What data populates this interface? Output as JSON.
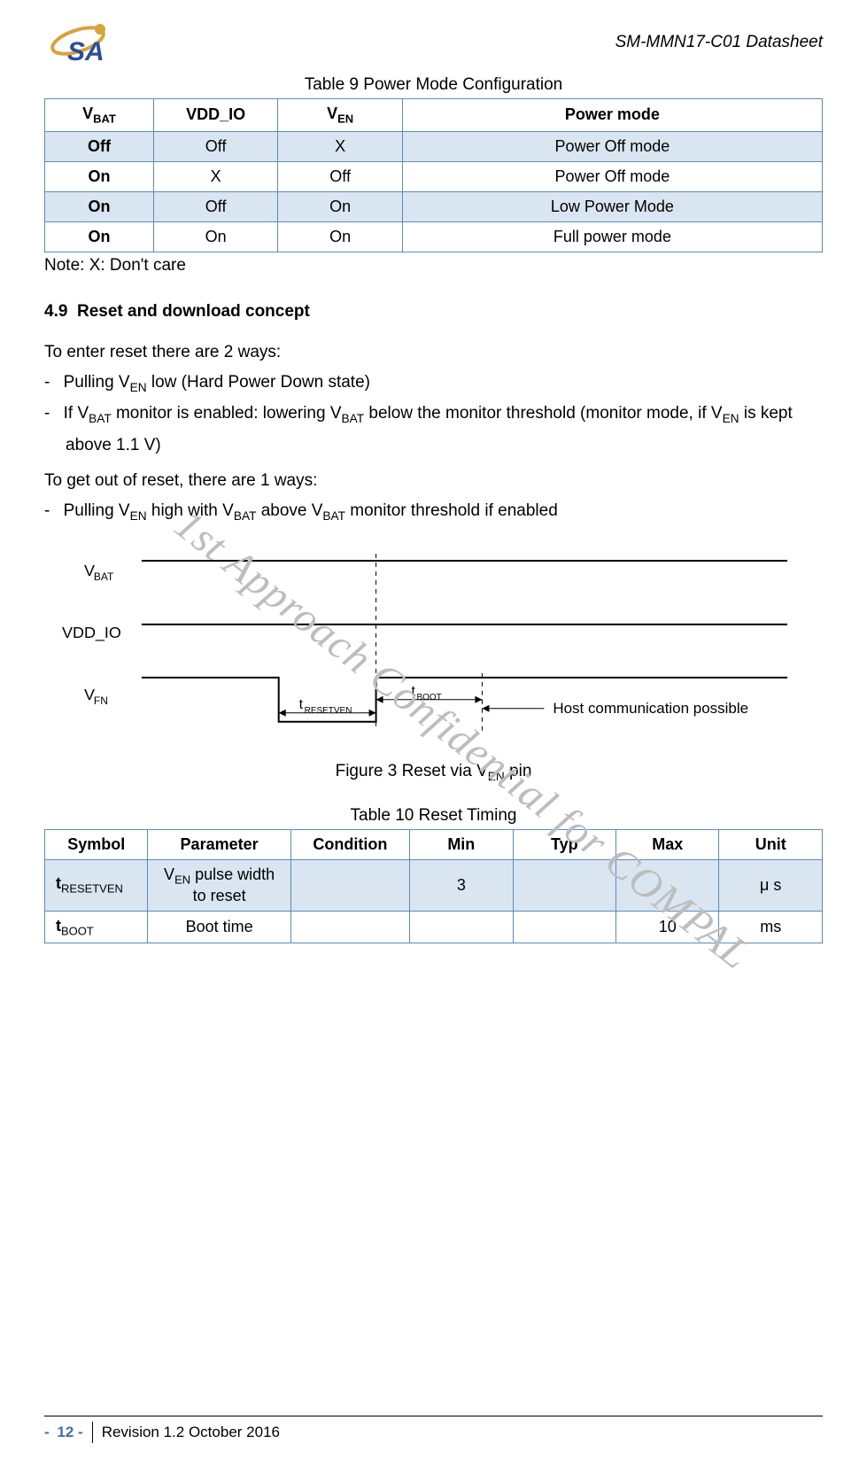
{
  "header": {
    "doc_title": "SM-MMN17-C01 Datasheet"
  },
  "table9": {
    "caption": "Table 9 Power Mode Configuration",
    "headers": {
      "c1_pre": "V",
      "c1_sub": "BAT",
      "c2": "VDD_IO",
      "c3_pre": "V",
      "c3_sub": "EN",
      "c4": "Power mode"
    },
    "rows": [
      {
        "vbat": "Off",
        "vdd": "Off",
        "ven": "X",
        "mode": "Power Off mode"
      },
      {
        "vbat": "On",
        "vdd": "X",
        "ven": "Off",
        "mode": "Power Off mode"
      },
      {
        "vbat": "On",
        "vdd": "Off",
        "ven": "On",
        "mode": "Low Power Mode"
      },
      {
        "vbat": "On",
        "vdd": "On",
        "ven": "On",
        "mode": "Full power mode"
      }
    ]
  },
  "note": "Note: X: Don't care",
  "section": {
    "num": "4.9",
    "title": "Reset and download concept",
    "intro1": "To enter reset there are 2 ways:",
    "b1a": "Pulling V",
    "b1b": "EN",
    "b1c": " low (Hard Power Down state)",
    "b2a": "If V",
    "b2b": "BAT",
    "b2c": " monitor is enabled: lowering V",
    "b2d": "BAT",
    "b2e": " below the monitor threshold (monitor mode, if V",
    "b2f": "EN",
    "b2g": " is kept above 1.1 V)",
    "intro2": "To get out of reset, there are 1 ways:",
    "b3a": "Pulling V",
    "b3b": "EN",
    "b3c": " high with V",
    "b3d": "BAT",
    "b3e": " above V",
    "b3f": "BAT",
    "b3g": " monitor threshold if enabled"
  },
  "figure": {
    "caption_pre": "Figure 3 Reset via V",
    "caption_sub": "EN",
    "caption_post": " pin",
    "labels": {
      "vbat_pre": "V",
      "vbat_sub": "BAT",
      "vddio": "VDD_IO",
      "ven_pre": "V",
      "ven_sub": "FN",
      "t_resetven_pre": "t",
      "t_resetven_sub": "RESETVEN",
      "t_boot_pre": "t",
      "t_boot_sub": "BOOT",
      "host": "Host communication possible"
    }
  },
  "table10": {
    "caption": "Table 10 Reset Timing",
    "headers": {
      "c1": "Symbol",
      "c2": "Parameter",
      "c3": "Condition",
      "c4": "Min",
      "c5": "Typ",
      "c6": "Max",
      "c7": "Unit"
    },
    "r1": {
      "sym_pre": "t",
      "sym_sub": "RESETVEN",
      "param_pre": "V",
      "param_sub": "EN",
      "param_post": " pulse width to reset",
      "cond": "",
      "min": "3",
      "typ": "",
      "max": "",
      "unit": "μ s"
    },
    "r2": {
      "sym_pre": "t",
      "sym_sub": "BOOT",
      "param": "Boot time",
      "cond": "",
      "min": "",
      "typ": "",
      "max": "10",
      "unit": "ms"
    }
  },
  "watermark": "1st Approach Confidential for COMPAL",
  "footer": {
    "page_dash": "- ",
    "page_num": "12 -",
    "revision": "Revision 1.2 October 2016"
  }
}
